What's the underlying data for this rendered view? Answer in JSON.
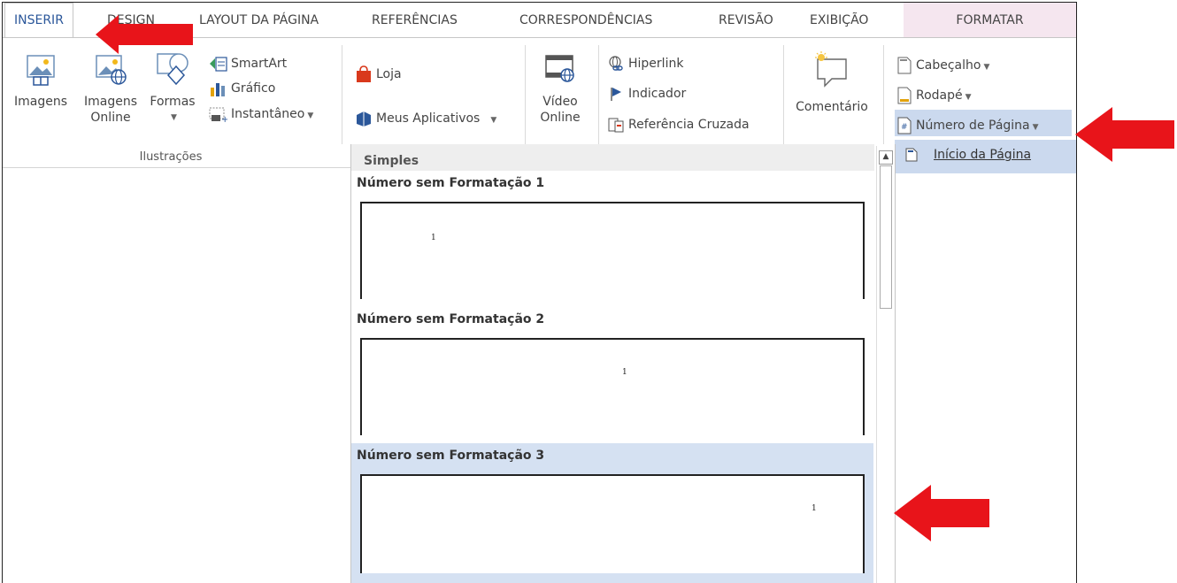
{
  "tabs": [
    {
      "label": "INSERIR",
      "active": true
    },
    {
      "label": "DESIGN",
      "active": false
    },
    {
      "label": "LAYOUT DA PÁGINA",
      "active": false
    },
    {
      "label": "REFERÊNCIAS",
      "active": false
    },
    {
      "label": "CORRESPONDÊNCIAS",
      "active": false
    },
    {
      "label": "REVISÃO",
      "active": false
    },
    {
      "label": "EXIBIÇÃO",
      "active": false
    },
    {
      "label": "FORMATAR",
      "active": false,
      "contextual": true
    }
  ],
  "illustrations": {
    "group_label": "Ilustrações",
    "imagens": "Imagens",
    "imagens_online_1": "Imagens",
    "imagens_online_2": "Online",
    "formas": "Formas",
    "smartart": "SmartArt",
    "grafico": "Gráfico",
    "instantaneo": "Instantâneo"
  },
  "apps": {
    "loja": "Loja",
    "meus_aplicativos": "Meus Aplicativos"
  },
  "media": {
    "video_1": "Vídeo",
    "video_2": "Online"
  },
  "links": {
    "hiperlink": "Hiperlink",
    "indicador": "Indicador",
    "referencia_cruzada": "Referência Cruzada"
  },
  "comments": {
    "comentario": "Comentário"
  },
  "header_footer": {
    "cabecalho": "Cabeçalho",
    "rodape": "Rodapé",
    "numero_pagina": "Número de Página"
  },
  "submenu": {
    "inicio_pagina": "Início da Página"
  },
  "gallery": {
    "section": "Simples",
    "items": [
      {
        "title": "Número sem Formatação 1",
        "number": "1",
        "align": "left"
      },
      {
        "title": "Número sem Formatação 2",
        "number": "1",
        "align": "center"
      },
      {
        "title": "Número sem Formatação 3",
        "number": "1",
        "align": "right",
        "highlighted": true
      }
    ]
  },
  "colors": {
    "accent": "#2b579a",
    "arrow": "#e8141a",
    "hover": "#cbd9ee"
  }
}
